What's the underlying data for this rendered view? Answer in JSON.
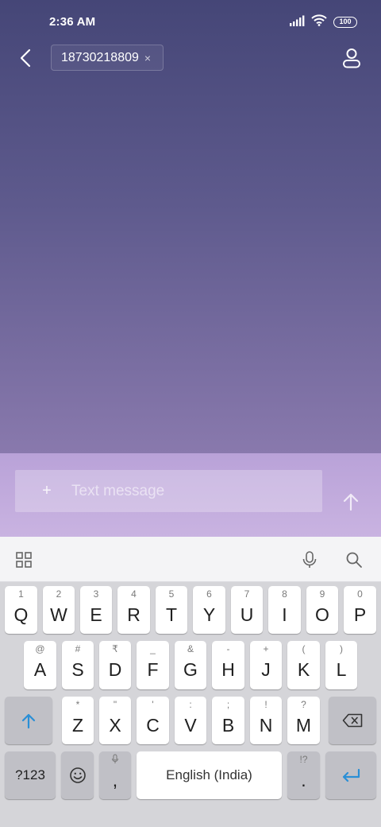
{
  "status": {
    "time": "2:36 AM",
    "battery": "100"
  },
  "header": {
    "recipient": "18730218809",
    "chip_remove": "×"
  },
  "compose": {
    "plus": "+",
    "placeholder": "Text message"
  },
  "keyboard": {
    "row1": [
      {
        "hint": "1",
        "label": "Q"
      },
      {
        "hint": "2",
        "label": "W"
      },
      {
        "hint": "3",
        "label": "E"
      },
      {
        "hint": "4",
        "label": "R"
      },
      {
        "hint": "5",
        "label": "T"
      },
      {
        "hint": "6",
        "label": "Y"
      },
      {
        "hint": "7",
        "label": "U"
      },
      {
        "hint": "8",
        "label": "I"
      },
      {
        "hint": "9",
        "label": "O"
      },
      {
        "hint": "0",
        "label": "P"
      }
    ],
    "row2": [
      {
        "hint": "@",
        "label": "A"
      },
      {
        "hint": "#",
        "label": "S"
      },
      {
        "hint": "₹",
        "label": "D"
      },
      {
        "hint": "_",
        "label": "F"
      },
      {
        "hint": "&",
        "label": "G"
      },
      {
        "hint": "-",
        "label": "H"
      },
      {
        "hint": "+",
        "label": "J"
      },
      {
        "hint": "(",
        "label": "K"
      },
      {
        "hint": ")",
        "label": "L"
      }
    ],
    "row3": [
      {
        "hint": "*",
        "label": "Z"
      },
      {
        "hint": "\"",
        "label": "X"
      },
      {
        "hint": "'",
        "label": "C"
      },
      {
        "hint": ":",
        "label": "V"
      },
      {
        "hint": ";",
        "label": "B"
      },
      {
        "hint": "!",
        "label": "N"
      },
      {
        "hint": "?",
        "label": "M"
      }
    ],
    "symbols_label": "?123",
    "comma_label": ",",
    "space_label": "English (India)",
    "period_hint": "!?",
    "period_label": ".",
    "accent_color": "#2a8fd6"
  }
}
